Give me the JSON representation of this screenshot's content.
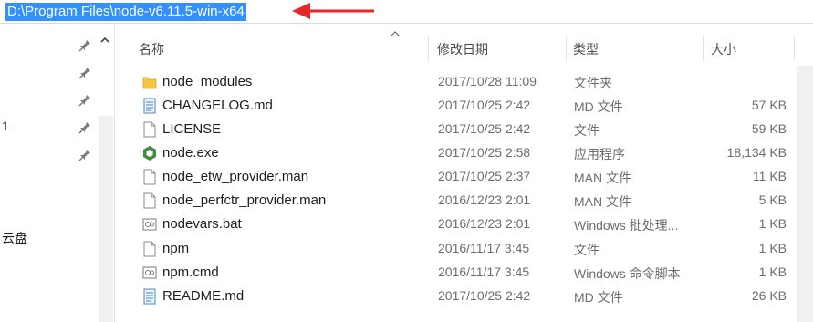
{
  "address": {
    "path": "D:\\Program Files\\node-v6.11.5-win-x64"
  },
  "nav": {
    "partial_label_1": "1",
    "partial_label_2": "云盘"
  },
  "columns": {
    "name": "名称",
    "modified": "修改日期",
    "type": "类型",
    "size": "大小"
  },
  "files": [
    {
      "name": "node_modules",
      "modified": "2017/10/28 11:09",
      "type": "文件夹",
      "size": "",
      "icon": "folder-icon"
    },
    {
      "name": "CHANGELOG.md",
      "modified": "2017/10/25 2:42",
      "type": "MD 文件",
      "size": "57 KB",
      "icon": "markdown-file-icon"
    },
    {
      "name": "LICENSE",
      "modified": "2017/10/25 2:42",
      "type": "文件",
      "size": "59 KB",
      "icon": "generic-file-icon"
    },
    {
      "name": "node.exe",
      "modified": "2017/10/25 2:58",
      "type": "应用程序",
      "size": "18,134 KB",
      "icon": "nodejs-app-icon"
    },
    {
      "name": "node_etw_provider.man",
      "modified": "2017/10/25 2:37",
      "type": "MAN 文件",
      "size": "11 KB",
      "icon": "generic-file-icon"
    },
    {
      "name": "node_perfctr_provider.man",
      "modified": "2016/12/23 2:01",
      "type": "MAN 文件",
      "size": "5 KB",
      "icon": "generic-file-icon"
    },
    {
      "name": "nodevars.bat",
      "modified": "2016/12/23 2:01",
      "type": "Windows 批处理...",
      "size": "1 KB",
      "icon": "batch-file-icon"
    },
    {
      "name": "npm",
      "modified": "2016/11/17 3:45",
      "type": "文件",
      "size": "1 KB",
      "icon": "generic-file-icon"
    },
    {
      "name": "npm.cmd",
      "modified": "2016/11/17 3:45",
      "type": "Windows 命令脚本",
      "size": "1 KB",
      "icon": "batch-file-icon"
    },
    {
      "name": "README.md",
      "modified": "2017/10/25 2:42",
      "type": "MD 文件",
      "size": "26 KB",
      "icon": "markdown-file-icon"
    }
  ],
  "colors": {
    "selection": "#3390ff",
    "annotation_arrow": "#e8262a",
    "node_green": "#3f8f3f"
  }
}
